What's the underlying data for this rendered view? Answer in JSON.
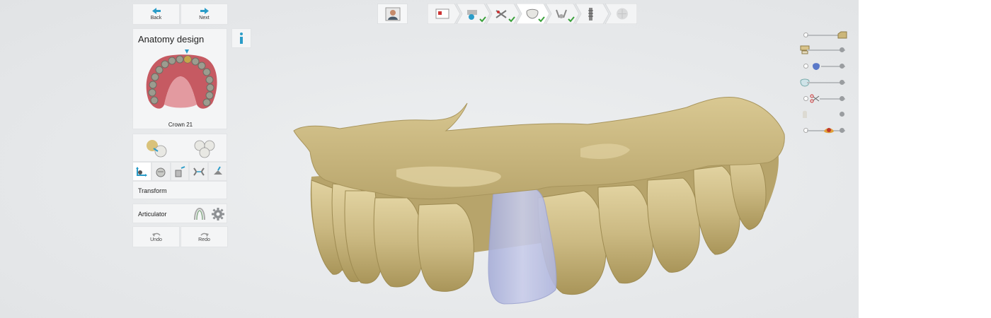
{
  "nav": {
    "back_label": "Back",
    "next_label": "Next"
  },
  "panel": {
    "title": "Anatomy design",
    "crown_label": "Crown 21",
    "transform_label": "Transform",
    "articulator_label": "Articulator",
    "undo_label": "Undo",
    "redo_label": "Redo"
  },
  "workflow": {
    "steps": [
      {
        "icon": "patient-card-icon",
        "done": false
      },
      {
        "icon": "scan-icon",
        "done": true
      },
      {
        "icon": "trim-icon",
        "done": true
      },
      {
        "icon": "crown-icon",
        "done": true,
        "current": true
      },
      {
        "icon": "hands-icon",
        "done": true
      },
      {
        "icon": "implant-icon",
        "done": false
      },
      {
        "icon": "mill-icon",
        "done": false
      }
    ]
  },
  "visibility": {
    "rows": [
      {
        "icon": "model-icon",
        "level": 0.95
      },
      {
        "icon": "antagonist-icon",
        "level": 1.0
      },
      {
        "icon": "crown-blue-icon",
        "level": 1.0
      },
      {
        "icon": "prep-icon",
        "level": 1.0
      },
      {
        "icon": "scissors-icon",
        "level": 1.0
      },
      {
        "icon": "tooth-icon",
        "level": 1.0
      },
      {
        "icon": "gingiva-icon",
        "level": 1.0
      }
    ]
  },
  "colors": {
    "accent": "#2a9cc8",
    "check": "#3aa13a",
    "model": "#cfbd8a",
    "crown": "#b7bde0"
  }
}
